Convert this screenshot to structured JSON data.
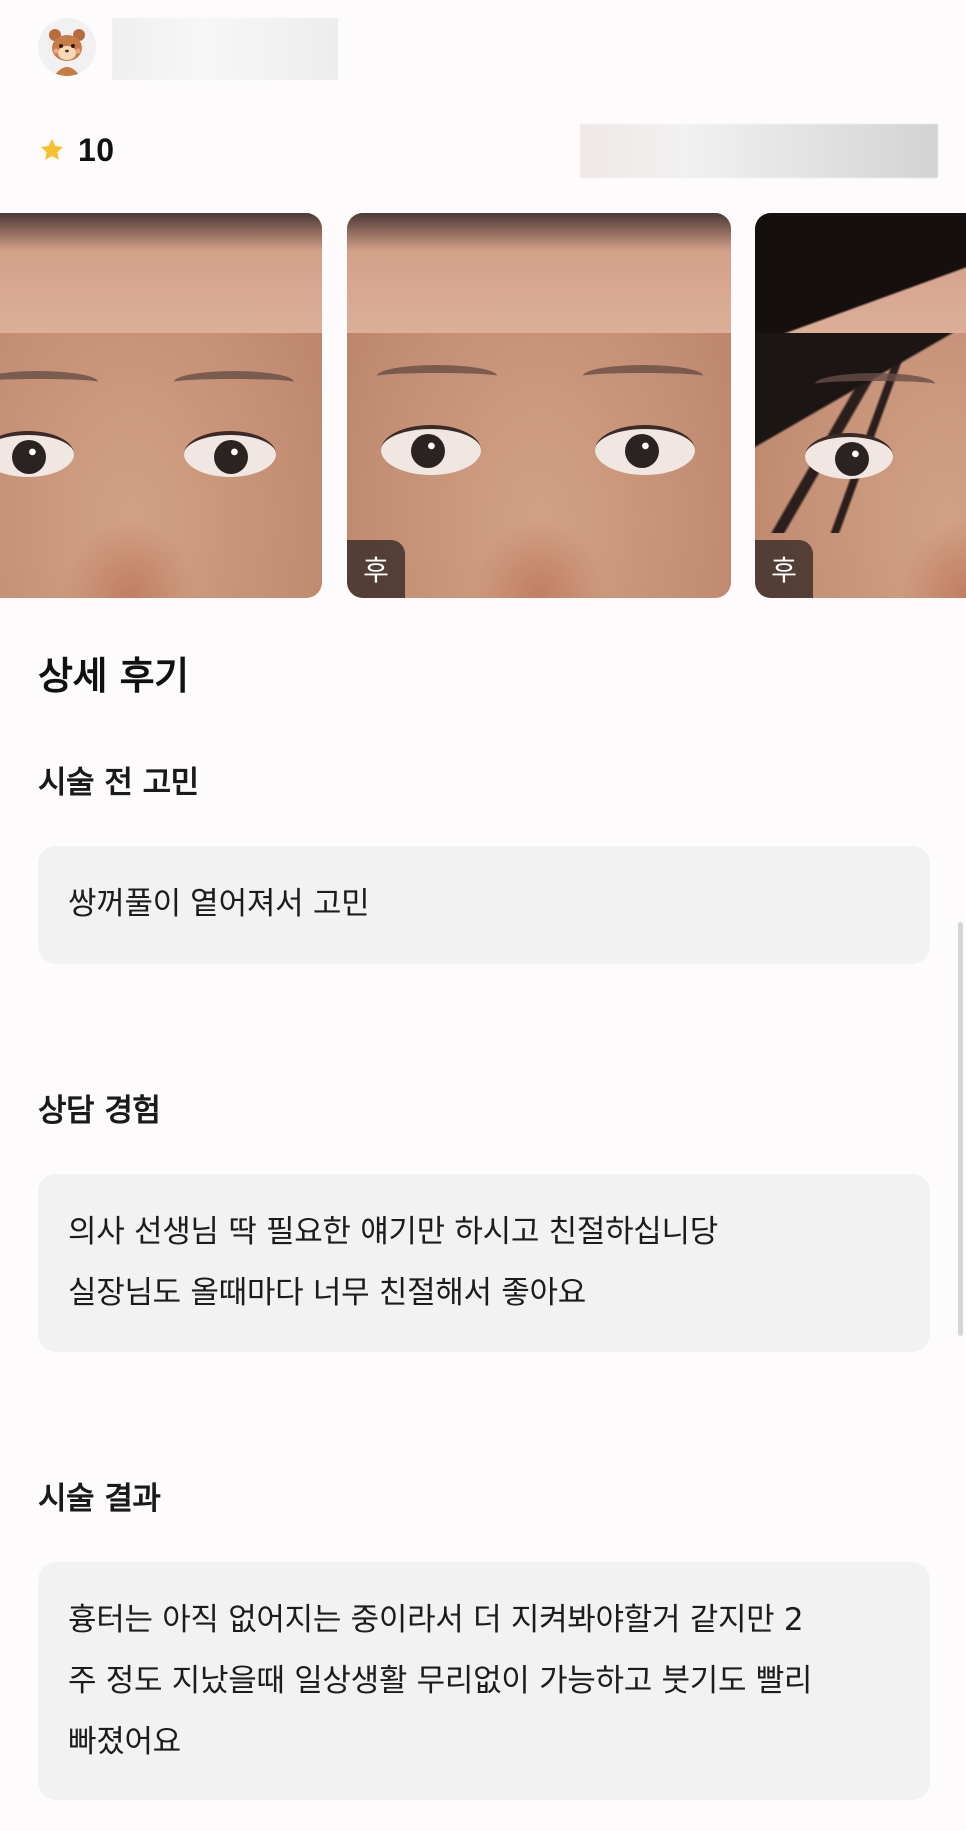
{
  "review": {
    "rating_value": "10",
    "photos": [
      {
        "badge": ""
      },
      {
        "badge": "후"
      },
      {
        "badge": "후"
      }
    ]
  },
  "detail": {
    "title": "상세 후기",
    "sections": [
      {
        "title": "시술 전 고민",
        "lines": [
          "쌍꺼풀이 옅어져서 고민"
        ]
      },
      {
        "title": "상담 경험",
        "lines": [
          "의사 선생님 딱 필요한 얘기만 하시고 친절하십니당",
          "실장님도 올때마다 너무 친절해서 좋아요"
        ]
      },
      {
        "title": "시술 결과",
        "lines": [
          "흉터는 아직 없어지는 중이라서 더 지켜봐야할거 같지만 2",
          "주 정도 지났을때 일상생활 무리없이 가능하고 붓기도 빨리",
          "빠졌어요"
        ]
      }
    ]
  },
  "colors": {
    "background": "#fdfbfb",
    "box": "#f2f2f2",
    "star": "#f5c12e",
    "badge": "#28201e"
  },
  "icons": {
    "avatar": "hamster-avatar-icon",
    "rating": "star-icon"
  }
}
